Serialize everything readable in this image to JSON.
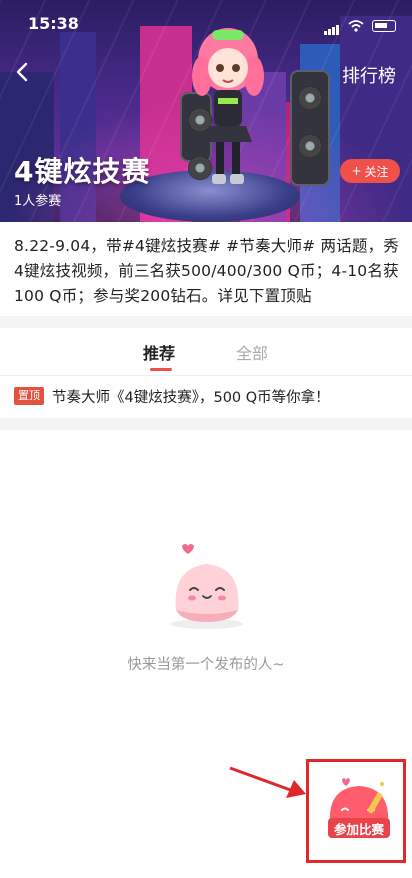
{
  "status_bar": {
    "time": "15:38"
  },
  "header": {
    "rank_label": "排行榜"
  },
  "contest": {
    "title": "4键炫技赛",
    "participants": "1人参赛",
    "follow_label": "关注",
    "description": "8.22-9.04，带#4键炫技赛# #节奏大师# 两话题，秀4键炫技视频，前三名获500/400/300 Q币；4-10名获100 Q币；参与奖200钻石。详见下置顶贴"
  },
  "tabs": [
    {
      "label": "推荐",
      "active": true
    },
    {
      "label": "全部",
      "active": false
    }
  ],
  "pinned": {
    "badge": "置顶",
    "text": "节奏大师《4键炫技赛》，500 Q币等你拿！"
  },
  "empty_state": {
    "text": "快来当第一个发布的人~"
  },
  "fab": {
    "label": "参加比赛"
  },
  "colors": {
    "accent": "#f0504a",
    "annotation": "#e0282c"
  }
}
